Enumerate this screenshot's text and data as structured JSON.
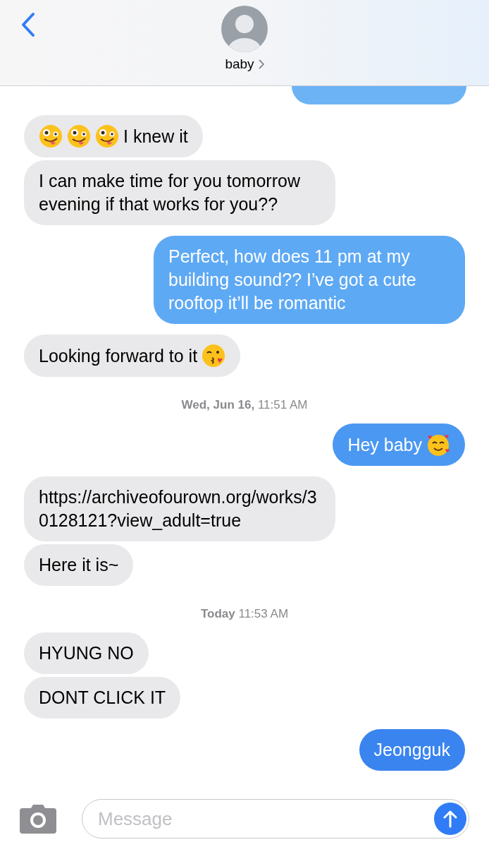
{
  "header": {
    "contact": "baby"
  },
  "messages": [
    {
      "kind": "sent_clipped",
      "color": "#6cb3f6"
    },
    {
      "kind": "received",
      "parts": [
        {
          "kind": "zany"
        },
        {
          "kind": "zany"
        },
        {
          "kind": "zany"
        },
        {
          "kind": "text",
          "text": "I knew it"
        }
      ]
    },
    {
      "kind": "received",
      "parts": [
        {
          "kind": "text",
          "text": "I can make time for you tomorrow evening if that works for you??"
        }
      ]
    },
    {
      "kind": "sent",
      "color": "#5ea9f4",
      "parts": [
        {
          "kind": "text",
          "text": "Perfect, how does 11 pm at my building sound?? I’ve got a cute rooftop it’ll be romantic"
        }
      ]
    },
    {
      "kind": "received",
      "parts": [
        {
          "kind": "text",
          "text": "Looking forward to it"
        },
        {
          "kind": "kiss"
        }
      ]
    },
    {
      "kind": "timestamp",
      "text": "**Wed, Jun 16,** 11:51 AM"
    },
    {
      "kind": "sent",
      "color": "#4b98f2",
      "parts": [
        {
          "kind": "text",
          "text": "Hey baby"
        },
        {
          "kind": "hearts"
        }
      ]
    },
    {
      "kind": "received",
      "parts": [
        {
          "kind": "link",
          "text": "https://archiveofourown.org/works/30128121?view_adult=true"
        }
      ]
    },
    {
      "kind": "received",
      "parts": [
        {
          "kind": "text",
          "text": "Here it is~"
        }
      ]
    },
    {
      "kind": "timestamp",
      "text": "**Today** 11:53 AM"
    },
    {
      "kind": "received",
      "parts": [
        {
          "kind": "text",
          "text": "HYUNG NO"
        }
      ]
    },
    {
      "kind": "received",
      "parts": [
        {
          "kind": "text",
          "text": "DONT CLICK IT"
        }
      ]
    },
    {
      "kind": "sent",
      "color": "#3a84f0",
      "parts": [
        {
          "kind": "text",
          "text": "Jeongguk"
        }
      ]
    }
  ],
  "composer": {
    "placeholder": "Message"
  }
}
